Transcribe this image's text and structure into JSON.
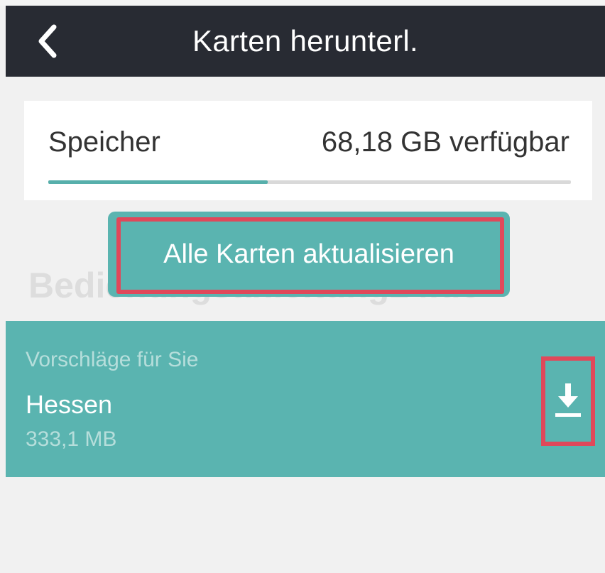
{
  "header": {
    "back_icon": "chevron-left-icon",
    "title": "Karten herunterl."
  },
  "storage": {
    "label": "Speicher",
    "available": "68,18 GB verfügbar",
    "used_fraction": 0.42
  },
  "update_all": {
    "label": "Alle Karten aktualisieren"
  },
  "watermark": {
    "text": "Bedienungsanleitung24.de"
  },
  "suggestions": {
    "heading": "Vorschläge für Sie",
    "items": [
      {
        "name": "Hessen",
        "size": "333,1 MB",
        "action_icon": "download-icon"
      }
    ]
  },
  "colors": {
    "header_bg": "#282b33",
    "accent_teal": "#5ab4b0",
    "highlight_red": "#e0485a",
    "background": "#f1f1f1"
  }
}
